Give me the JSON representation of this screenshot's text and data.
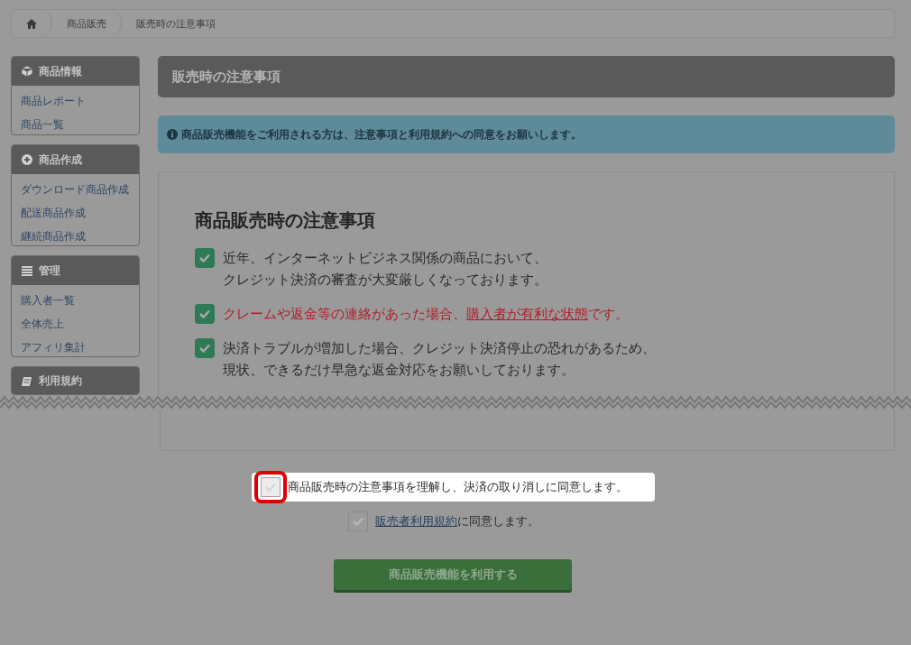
{
  "breadcrumb": [
    {
      "label": "商品販売"
    },
    {
      "label": "販売時の注意事項"
    }
  ],
  "sidebar": {
    "groups": [
      {
        "title": "商品情報",
        "items": [
          "商品レポート",
          "商品一覧"
        ]
      },
      {
        "title": "商品作成",
        "items": [
          "ダウンロード商品作成",
          "配送商品作成",
          "継続商品作成"
        ]
      },
      {
        "title": "管理",
        "items": [
          "購入者一覧",
          "全体売上",
          "アフィリ集計"
        ]
      },
      {
        "title": "利用規約"
      }
    ]
  },
  "page_title": "販売時の注意事項",
  "info_alert": "商品販売機能をご利用される方は、注意事項と利用規約への同意をお願いします。",
  "notice": {
    "heading": "商品販売時の注意事項",
    "items": [
      {
        "checked": true,
        "alert": false,
        "lines": [
          [
            {
              "text": "近年、インターネットビジネス関係の商品において、",
              "underline": false
            }
          ],
          [
            {
              "text": "クレジット決済の審査が大変厳しくなっております。",
              "underline": false
            }
          ]
        ]
      },
      {
        "checked": true,
        "alert": true,
        "lines": [
          [
            {
              "text": "クレームや返金等の連絡があった場合、",
              "underline": false
            },
            {
              "text": "購入者が有利な状態",
              "underline": true
            },
            {
              "text": "です。",
              "underline": false
            }
          ]
        ]
      },
      {
        "checked": true,
        "alert": false,
        "lines": [
          [
            {
              "text": "決済トラブルが増加した場合、クレジット決済停止の恐れがあるため、",
              "underline": false
            }
          ],
          [
            {
              "text": "現状、できるだけ早急な返金対応をお願いしております。",
              "underline": false
            }
          ]
        ]
      }
    ]
  },
  "agreements": [
    {
      "checked": false,
      "highlighted": true,
      "parts": [
        {
          "text": "商品販売時の注意事項を理解し、決済の取り消しに同意します。",
          "link": false
        }
      ]
    },
    {
      "checked": false,
      "highlighted": false,
      "parts": [
        {
          "text": "販売者利用規約",
          "link": true
        },
        {
          "text": "に同意します。",
          "link": false
        }
      ]
    }
  ],
  "submit_button": "商品販売機能を利用する"
}
